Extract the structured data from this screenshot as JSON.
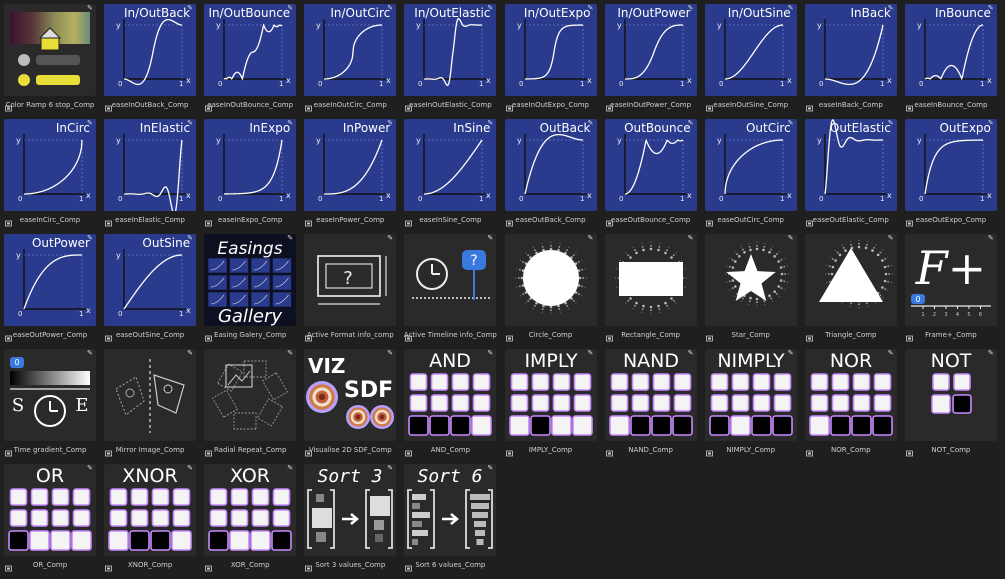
{
  "colors": {
    "background": "#1f1f1f",
    "thumb_dark": "#2a2a2a",
    "thumb_blue": "#2a3a8c",
    "logic_border": "#c889ff",
    "viz_ring": "#c35f3a"
  },
  "items": [
    {
      "label": "Color Ramp 6 stop_Comp",
      "kind": "ramp"
    },
    {
      "label": "easeInOutBack_Comp",
      "kind": "ease",
      "title": "In/OutBack",
      "curve": "inOutBack"
    },
    {
      "label": "easeInOutBounce_Comp",
      "kind": "ease",
      "title": "In/OutBounce",
      "curve": "inOutBounce"
    },
    {
      "label": "easeInOutCirc_Comp",
      "kind": "ease",
      "title": "In/OutCirc",
      "curve": "inOutCirc"
    },
    {
      "label": "easeInOutElastic_Comp",
      "kind": "ease",
      "title": "In/OutElastic",
      "curve": "inOutElastic"
    },
    {
      "label": "easeInOutExpo_Comp",
      "kind": "ease",
      "title": "In/OutExpo",
      "curve": "inOutExpo"
    },
    {
      "label": "easeInOutPower_Comp",
      "kind": "ease",
      "title": "In/OutPower",
      "curve": "inOutPower"
    },
    {
      "label": "easeInOutSine_Comp",
      "kind": "ease",
      "title": "In/OutSine",
      "curve": "inOutSine"
    },
    {
      "label": "easeInBack_Comp",
      "kind": "ease",
      "title": "InBack",
      "curve": "inBack"
    },
    {
      "label": "easeInBounce_Comp",
      "kind": "ease",
      "title": "InBounce",
      "curve": "inBounce"
    },
    {
      "label": "easeInCirc_Comp",
      "kind": "ease",
      "title": "InCirc",
      "curve": "inCirc"
    },
    {
      "label": "easeInElastic_Comp",
      "kind": "ease",
      "title": "InElastic",
      "curve": "inElastic"
    },
    {
      "label": "easeInExpo_Comp",
      "kind": "ease",
      "title": "InExpo",
      "curve": "inExpo"
    },
    {
      "label": "easeInPower_Comp",
      "kind": "ease",
      "title": "InPower",
      "curve": "inPower"
    },
    {
      "label": "easeInSine_Comp",
      "kind": "ease",
      "title": "InSine",
      "curve": "inSine"
    },
    {
      "label": "easeOutBack_Comp",
      "kind": "ease",
      "title": "OutBack",
      "curve": "outBack"
    },
    {
      "label": "easeOutBounce_Comp",
      "kind": "ease",
      "title": "OutBounce",
      "curve": "outBounce"
    },
    {
      "label": "easeOutCirc_Comp",
      "kind": "ease",
      "title": "OutCirc",
      "curve": "outCirc"
    },
    {
      "label": "easeOutElastic_Comp",
      "kind": "ease",
      "title": "OutElastic",
      "curve": "outElastic"
    },
    {
      "label": "easeOutExpo_Comp",
      "kind": "ease",
      "title": "OutExpo",
      "curve": "outExpo"
    },
    {
      "label": "easeOutPower_Comp",
      "kind": "ease",
      "title": "OutPower",
      "curve": "outPower"
    },
    {
      "label": "easeOutSine_Comp",
      "kind": "ease",
      "title": "OutSine",
      "curve": "outSine"
    },
    {
      "label": "Easing Galery_Comp",
      "kind": "gallery",
      "line1": "Easings",
      "line2": "Gallery"
    },
    {
      "label": "Active Format info_comp",
      "kind": "format",
      "glyph": "?"
    },
    {
      "label": "Active Timeline info_Comp",
      "kind": "timeline",
      "glyph": "?"
    },
    {
      "label": "Circle_Comp",
      "kind": "circle"
    },
    {
      "label": "Rectangle_Comp",
      "kind": "rect"
    },
    {
      "label": "Star_Comp",
      "kind": "star"
    },
    {
      "label": "Triangle_Comp",
      "kind": "triangle"
    },
    {
      "label": "Frame+_Comp",
      "kind": "frame",
      "big": "F+",
      "badge": "0",
      "ticks": [
        "1",
        "2",
        "3",
        "4",
        "5",
        "6"
      ]
    },
    {
      "label": "Time gradient_Comp",
      "kind": "timegrad",
      "badge": "0",
      "left": "S",
      "right": "E"
    },
    {
      "label": "Mirror Image_Comp",
      "kind": "mirror"
    },
    {
      "label": "Radial Repeat_Comp",
      "kind": "radial"
    },
    {
      "label": "Visualise 2D SDF_Comp",
      "kind": "viz",
      "t1": "VIZ",
      "t2": "SDF"
    },
    {
      "label": "AND_Comp",
      "kind": "logic",
      "title": "AND",
      "pattern": [
        [
          0,
          0,
          0,
          0
        ],
        [
          0,
          0,
          0,
          0
        ],
        [
          1,
          1,
          1,
          0
        ]
      ]
    },
    {
      "label": "IMPLY_Comp",
      "kind": "logic",
      "title": "IMPLY",
      "pattern": [
        [
          0,
          0,
          0,
          0
        ],
        [
          0,
          0,
          0,
          0
        ],
        [
          0,
          1,
          0,
          0
        ]
      ]
    },
    {
      "label": "NAND_Comp",
      "kind": "logic",
      "title": "NAND",
      "pattern": [
        [
          0,
          0,
          0,
          0
        ],
        [
          0,
          0,
          0,
          0
        ],
        [
          0,
          1,
          1,
          1
        ]
      ]
    },
    {
      "label": "NIMPLY_Comp",
      "kind": "logic",
      "title": "NIMPLY",
      "pattern": [
        [
          0,
          0,
          0,
          0
        ],
        [
          0,
          0,
          0,
          0
        ],
        [
          1,
          0,
          1,
          1
        ]
      ]
    },
    {
      "label": "NOR_Comp",
      "kind": "logic",
      "title": "NOR",
      "pattern": [
        [
          0,
          0,
          0,
          0
        ],
        [
          0,
          0,
          0,
          0
        ],
        [
          0,
          1,
          1,
          1
        ]
      ]
    },
    {
      "label": "NOT_Comp",
      "kind": "not",
      "title": "NOT",
      "pattern": [
        [
          0,
          0
        ],
        [
          0,
          1
        ]
      ]
    },
    {
      "label": "OR_Comp",
      "kind": "logic",
      "title": "OR",
      "pattern": [
        [
          0,
          0,
          0,
          0
        ],
        [
          0,
          0,
          0,
          0
        ],
        [
          1,
          0,
          0,
          0
        ]
      ]
    },
    {
      "label": "XNOR_Comp",
      "kind": "logic",
      "title": "XNOR",
      "pattern": [
        [
          0,
          0,
          0,
          0
        ],
        [
          0,
          0,
          0,
          0
        ],
        [
          0,
          1,
          1,
          0
        ]
      ]
    },
    {
      "label": "XOR_Comp",
      "kind": "logic",
      "title": "XOR",
      "pattern": [
        [
          0,
          0,
          0,
          0
        ],
        [
          0,
          0,
          0,
          0
        ],
        [
          1,
          0,
          0,
          1
        ]
      ]
    },
    {
      "label": "Sort 3 values_Comp",
      "kind": "sort3",
      "title": "Sort 3"
    },
    {
      "label": "Sort 6 values_Comp",
      "kind": "sort6",
      "title": "Sort 6"
    }
  ],
  "graph_labels": {
    "y": "y",
    "x": "x",
    "zero": "0",
    "one": "1"
  }
}
